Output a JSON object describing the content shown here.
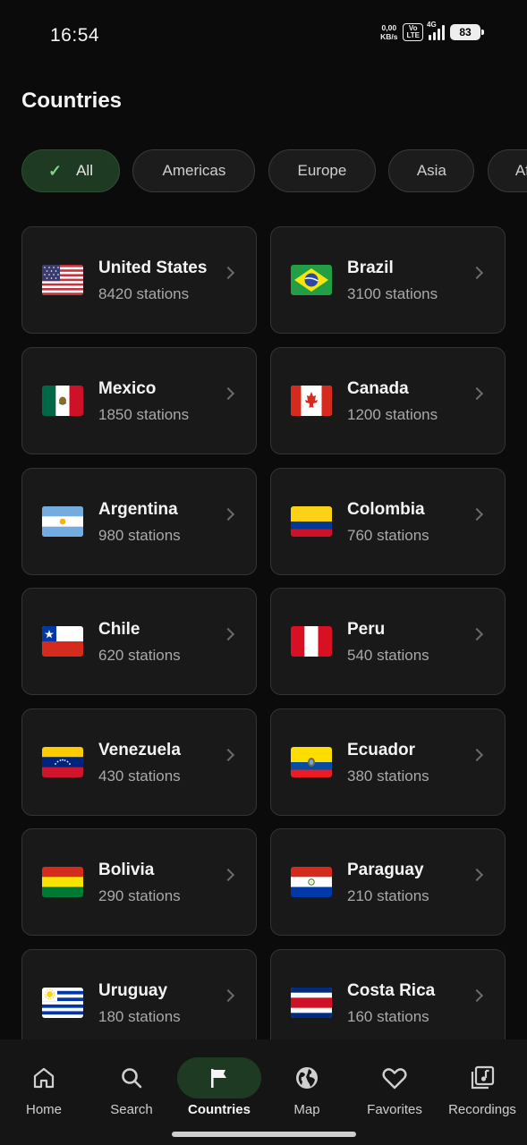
{
  "status_bar": {
    "time": "16:54",
    "net_speed_value": "0,00",
    "net_speed_unit": "KB/s",
    "volte_top": "Vo",
    "volte_bottom": "LTE",
    "network": "4G",
    "battery": "83"
  },
  "page": {
    "title": "Countries"
  },
  "filters": [
    {
      "label": "All",
      "selected": true
    },
    {
      "label": "Americas",
      "selected": false
    },
    {
      "label": "Europe",
      "selected": false
    },
    {
      "label": "Asia",
      "selected": false
    },
    {
      "label": "Africa",
      "selected": false
    }
  ],
  "countries": [
    {
      "name": "United States",
      "stations": "8420 stations",
      "flag_icon": "us-flag-icon"
    },
    {
      "name": "Brazil",
      "stations": "3100 stations",
      "flag_icon": "brazil-flag-icon"
    },
    {
      "name": "Mexico",
      "stations": "1850 stations",
      "flag_icon": "mexico-flag-icon"
    },
    {
      "name": "Canada",
      "stations": "1200 stations",
      "flag_icon": "canada-flag-icon"
    },
    {
      "name": "Argentina",
      "stations": "980 stations",
      "flag_icon": "argentina-flag-icon"
    },
    {
      "name": "Colombia",
      "stations": "760 stations",
      "flag_icon": "colombia-flag-icon"
    },
    {
      "name": "Chile",
      "stations": "620 stations",
      "flag_icon": "chile-flag-icon"
    },
    {
      "name": "Peru",
      "stations": "540 stations",
      "flag_icon": "peru-flag-icon"
    },
    {
      "name": "Venezuela",
      "stations": "430 stations",
      "flag_icon": "venezuela-flag-icon"
    },
    {
      "name": "Ecuador",
      "stations": "380 stations",
      "flag_icon": "ecuador-flag-icon"
    },
    {
      "name": "Bolivia",
      "stations": "290 stations",
      "flag_icon": "bolivia-flag-icon"
    },
    {
      "name": "Paraguay",
      "stations": "210 stations",
      "flag_icon": "paraguay-flag-icon"
    },
    {
      "name": "Uruguay",
      "stations": "180 stations",
      "flag_icon": "uruguay-flag-icon"
    },
    {
      "name": "Costa Rica",
      "stations": "160 stations",
      "flag_icon": "costa-rica-flag-icon"
    }
  ],
  "bottom_nav": [
    {
      "label": "Home",
      "icon": "home-icon",
      "active": false
    },
    {
      "label": "Search",
      "icon": "search-icon",
      "active": false
    },
    {
      "label": "Countries",
      "icon": "flag-icon",
      "active": true
    },
    {
      "label": "Map",
      "icon": "globe-icon",
      "active": false
    },
    {
      "label": "Favorites",
      "icon": "heart-icon",
      "active": false
    },
    {
      "label": "Recordings",
      "icon": "music-library-icon",
      "active": false
    }
  ],
  "colors": {
    "background": "#0b0b0b",
    "card": "#191919",
    "accent_active": "#1f3a23",
    "check": "#7fd38a"
  }
}
